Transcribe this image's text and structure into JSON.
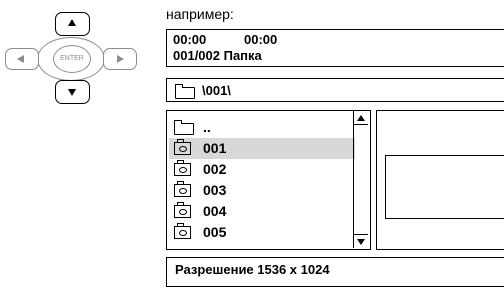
{
  "caption": "например:",
  "status": {
    "time_elapsed": "00:00",
    "time_total": "00:00",
    "track_info": "001/002 Папка"
  },
  "path": "\\001\\",
  "file_list": {
    "parent": "..",
    "items": [
      "001",
      "002",
      "003",
      "004",
      "005"
    ],
    "selected": "001"
  },
  "info": "Разрешение 1536 x 1024",
  "remote": {
    "enter_label": "ENTER"
  },
  "icons": {
    "folder": "folder-icon",
    "photo": "photo-folder-icon"
  }
}
